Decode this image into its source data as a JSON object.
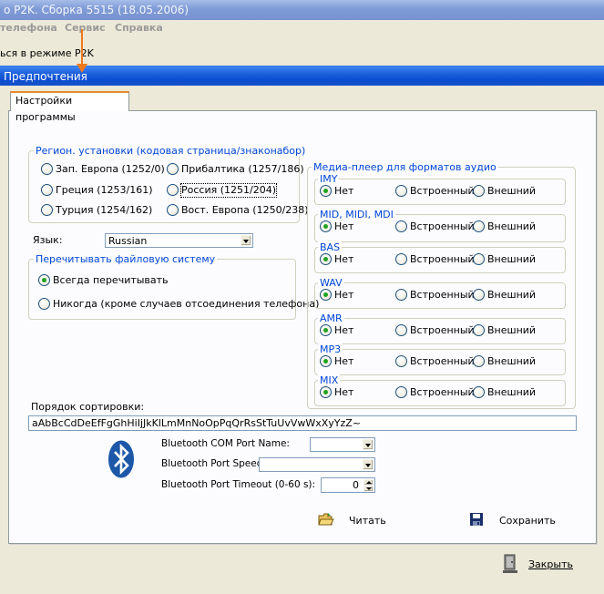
{
  "app": {
    "title": "о P2K. Сборка 5515 (18.05.2006)",
    "menu": [
      "телефона",
      "Сервис",
      "Справка"
    ],
    "status_text": "ься в режиме P2K"
  },
  "dialog": {
    "title": "Предпочтения",
    "tab": "Настройки программы",
    "region": {
      "caption": "Регион. установки (кодовая страница/знаконабор)",
      "options": [
        {
          "label": "Зап. Европа (1252/0)",
          "selected": false
        },
        {
          "label": "Прибалтика (1257/186)",
          "selected": false
        },
        {
          "label": "Греция (1253/161)",
          "selected": false
        },
        {
          "label": "Россия (1251/204)",
          "selected": false
        },
        {
          "label": "Турция (1254/162)",
          "selected": false
        },
        {
          "label": "Вост. Европа (1250/238)",
          "selected": false
        }
      ]
    },
    "language": {
      "label": "Язык:",
      "value": "Russian"
    },
    "rescan": {
      "caption": "Перечитывать файловую систему",
      "options": [
        {
          "label": "Всегда перечитывать",
          "selected": true
        },
        {
          "label": "Никогда (кроме случаев отсоединения телефона)",
          "selected": false
        }
      ]
    },
    "media": {
      "caption": "Медиа-плеер для форматов аудио",
      "choices": [
        "Нет",
        "Встроенный",
        "Внешний"
      ],
      "formats": [
        {
          "name": "IMY",
          "selected": "Нет"
        },
        {
          "name": "MID, MIDI, MDI",
          "selected": "Нет"
        },
        {
          "name": "BAS",
          "selected": "Нет"
        },
        {
          "name": "WAV",
          "selected": "Нет"
        },
        {
          "name": "AMR",
          "selected": "Нет"
        },
        {
          "name": "MP3",
          "selected": "Нет"
        },
        {
          "name": "MIX",
          "selected": "Нет"
        }
      ]
    },
    "sort": {
      "label": "Порядок сортировки:",
      "value": "aAbBcCdDeEfFgGhHiIjJkKlLmMnNoOpPqQrRsStTuUvVwWxXyYzZ~"
    },
    "bluetooth": {
      "icon": "bluetooth-icon",
      "com_port_label": "Bluetooth COM Port Name:",
      "com_port_value": "",
      "speed_label": "Bluetooth Port Speed:",
      "speed_value": "",
      "timeout_label": "Bluetooth Port Timeout (0-60 s):",
      "timeout_value": "0"
    },
    "buttons": {
      "read": "Читать",
      "save": "Сохранить",
      "close": "Закрыть"
    }
  },
  "colors": {
    "dialog_title": "#0b4dd1",
    "group_caption": "#0046d5",
    "radio_dot": "#21a121",
    "bluetooth": "#1c57a8",
    "annotation_arrow": "#f07a1b"
  }
}
